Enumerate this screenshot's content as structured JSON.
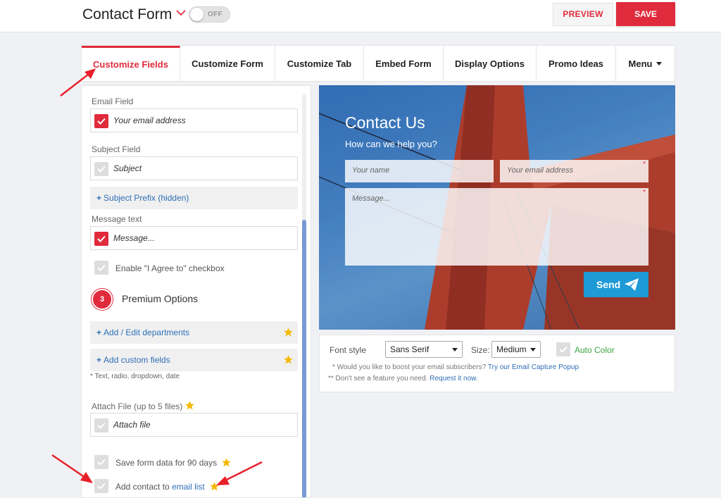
{
  "header": {
    "title": "Contact Form",
    "toggle_label": "OFF",
    "preview_label": "PREVIEW",
    "save_label": "SAVE"
  },
  "tabs": [
    {
      "label": "Customize Fields",
      "active": true
    },
    {
      "label": "Customize Form"
    },
    {
      "label": "Customize Tab"
    },
    {
      "label": "Embed Form"
    },
    {
      "label": "Display Options"
    },
    {
      "label": "Promo Ideas"
    },
    {
      "label": "Menu"
    }
  ],
  "fields": {
    "email_label": "Email Field",
    "email_placeholder": "Your email address",
    "subject_label": "Subject Field",
    "subject_placeholder": "Subject",
    "subject_prefix": "Subject Prefix (hidden)",
    "message_label": "Message text",
    "message_placeholder": "Message...",
    "agree_label": "Enable \"I Agree to\" checkbox"
  },
  "premium": {
    "badge": "3",
    "title": "Premium Options",
    "departments": "Add / Edit departments",
    "custom_fields": "Add custom fields",
    "custom_fields_note": "* Text, radio, dropdown, date",
    "attach_label": "Attach File (up to 5 files)",
    "attach_placeholder": "Attach file",
    "save_data": "Save form data for 90 days",
    "add_contact_prefix": "Add contact to",
    "add_contact_link": "email list"
  },
  "preview": {
    "title": "Contact Us",
    "subtitle": "How can we help you?",
    "name_placeholder": "Your name",
    "email_placeholder": "Your email address",
    "message_placeholder": "Message...",
    "required_mark": "*",
    "send_label": "Send"
  },
  "style": {
    "font_style_label": "Font style",
    "font_style_value": "Sans Serif",
    "size_label": "Size:",
    "size_value": "Medium",
    "auto_color_label": "Auto Color",
    "note1_prefix": "* Would you like to boost your email subscribers?",
    "note1_link": "Try our Email Capture Popup",
    "note2_prefix": "** Don't see a feature you need.",
    "note2_link": "Request it now."
  },
  "colors": {
    "accent": "#e02b3c",
    "link": "#2f6fb7",
    "send": "#1e9ad6",
    "star": "#f5b800",
    "auto_color": "#3aa845"
  },
  "icons": [
    "chevron-down-icon",
    "check-icon",
    "star-icon",
    "paper-plane-icon",
    "caret-down-icon",
    "red-arrow-icon"
  ]
}
